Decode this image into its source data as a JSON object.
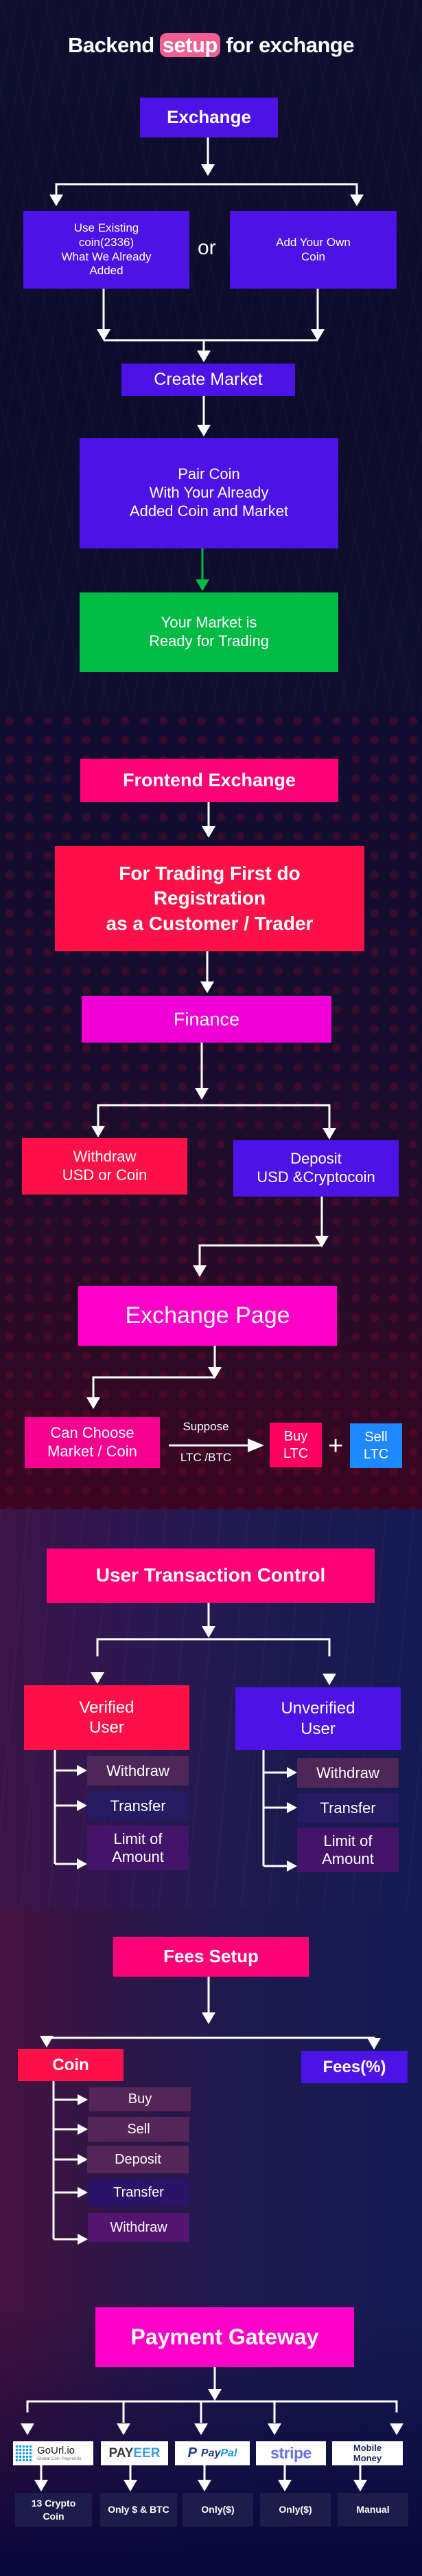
{
  "backend": {
    "title_before": "Backend",
    "title_highlight": "setup",
    "title_after": "for exchange",
    "exchange": "Exchange",
    "use_existing": "Use Existing\ncoin(2336)\nWhat We Already\nAdded",
    "or": "or",
    "add_own": "Add Your Own\nCoin",
    "create_market": "Create Market",
    "pair_coin": "Pair Coin\nWith Your Already\nAdded Coin and Market",
    "ready": "Your Market is\nReady for Trading"
  },
  "frontend": {
    "title": "Frontend Exchange",
    "registration": "For Trading First do\nRegistration\nas a Customer / Trader",
    "finance": "Finance",
    "withdraw": "Withdraw\nUSD or Coin",
    "deposit": "Deposit\nUSD &Cryptocoin",
    "exchange_page": "Exchange Page",
    "choose": "Can Choose\nMarket / Coin",
    "suppose": "Suppose",
    "pair": "LTC /BTC",
    "buy": "Buy\nLTC",
    "plus": "+",
    "sell": "Sell\nLTC"
  },
  "user_control": {
    "title": "User Transaction Control",
    "verified": "Verified\nUser",
    "unverified": "Unverified\nUser",
    "verified_items": [
      "Withdraw",
      "Transfer",
      "Limit of\nAmount"
    ],
    "unverified_items": [
      "Withdraw",
      "Transfer",
      "Limit of\nAmount"
    ]
  },
  "fees": {
    "title": "Fees Setup",
    "coin": "Coin",
    "fees_pct": "Fees(%)",
    "coin_items": [
      "Buy",
      "Sell",
      "Deposit",
      "Transfer",
      "Withdraw"
    ]
  },
  "payment": {
    "title": "Payment Gateway",
    "gateways": [
      {
        "name": "GoUrl.io",
        "tagline": "Global Coin Payments",
        "label": "13 Crypto\nCoin"
      },
      {
        "name": "PAYEER",
        "name_a": "PAY",
        "name_b": "EER",
        "label": "Only $ & BTC"
      },
      {
        "name": "PayPal",
        "name_a": "Pay",
        "name_b": "Pal",
        "label": "Only($)"
      },
      {
        "name": "stripe",
        "label": "Only($)"
      },
      {
        "name": "Mobile\nMoney",
        "label": "Manual"
      }
    ]
  },
  "colors": {
    "purple": "#4d12e6",
    "green": "#00bb44",
    "pink": "#ff0076",
    "red": "#ff1148",
    "magenta": "#f000d4",
    "blue": "#1e88ff",
    "highlight": "#f0608f",
    "green_arrow": "#00bb44"
  }
}
